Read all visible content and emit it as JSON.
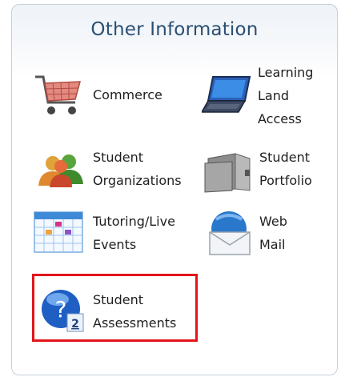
{
  "panel": {
    "title": "Other Information",
    "items": [
      {
        "label": "Commerce",
        "icon": "shopping-cart-icon"
      },
      {
        "label": "Learning\nLand\nAccess",
        "icon": "laptop-icon"
      },
      {
        "label": "Student\nOrganizations",
        "icon": "users-group-icon"
      },
      {
        "label": "Student\nPortfolio",
        "icon": "portfolio-folder-icon"
      },
      {
        "label": "Tutoring/Live\nEvents",
        "icon": "calendar-icon"
      },
      {
        "label": "Web\nMail",
        "icon": "mail-envelope-icon"
      },
      {
        "label": "Student\nAssessments",
        "icon": "assessment-question-icon",
        "badge": "2",
        "highlighted": true
      }
    ]
  },
  "colors": {
    "title": "#2a4f73",
    "highlight_border": "#e3141b",
    "panel_border": "#c8cfd6"
  }
}
